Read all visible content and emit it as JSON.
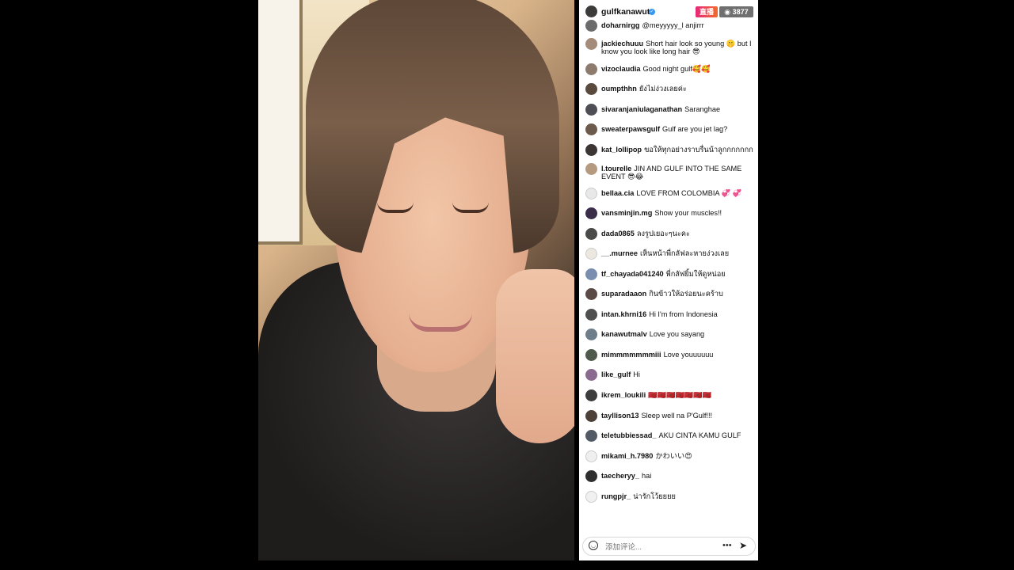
{
  "header": {
    "username": "gulfkanawut",
    "live_badge": "直播",
    "viewer_count": "3877"
  },
  "comments": [
    {
      "user": "doharnirgg",
      "text": "@meyyyyy_l anjirrr",
      "avatar_color": "#6b6b6b"
    },
    {
      "user": "jackiechuuu",
      "text": "Short hair look so young 🤫 but I know you look like long hair 😎",
      "avatar_color": "#a48b7a"
    },
    {
      "user": "vizoclaudia",
      "text": "Good night gulf🥰🥰",
      "avatar_color": "#8d7b6e"
    },
    {
      "user": "oumpthhn",
      "text": "ยังไม่ง่วงเลยค่ะ",
      "avatar_color": "#5a4a3e"
    },
    {
      "user": "sivaranjaniulaganathan",
      "text": "Saranghae",
      "avatar_color": "#4e4e55"
    },
    {
      "user": "sweaterpawsgulf",
      "text": "Gulf are you jet lag?",
      "avatar_color": "#6c5a4c"
    },
    {
      "user": "kat_lollipop",
      "text": "ขอให้ทุกอย่างราบรื่นน้าลูกกกกกกก",
      "avatar_color": "#3b3534"
    },
    {
      "user": "l.tourelle",
      "text": "JIN AND GULF INTO THE SAME EVENT 😎😂",
      "avatar_color": "#b59a7f"
    },
    {
      "user": "bellaa.cia",
      "text": "LOVE FROM COLOMBIA 💞 💞",
      "avatar_color": "#e8e8e8"
    },
    {
      "user": "vansminjin.mg",
      "text": "Show your muscles!!",
      "avatar_color": "#3a2d4a"
    },
    {
      "user": "dada0865",
      "text": "ลงรูปเยอะๆนะคะ",
      "avatar_color": "#4a4a48"
    },
    {
      "user": "__.murnee",
      "text": "เห็นหน้าพี่กลัฟละหายง่วงเลย",
      "avatar_color": "#ece8df"
    },
    {
      "user": "tf_chayada041240",
      "text": "พี่กลัฟยิ้มให้ดูหน่อย",
      "avatar_color": "#7a8fb0"
    },
    {
      "user": "suparadaaon",
      "text": "กินข้าวให้อร่อยนะคร้าบ",
      "avatar_color": "#5a4a46"
    },
    {
      "user": "intan.khrni16",
      "text": "Hi I'm from Indonesia",
      "avatar_color": "#4f4f4f"
    },
    {
      "user": "kanawutmalv",
      "text": "Love you sayang",
      "avatar_color": "#6d7d8a"
    },
    {
      "user": "mimmmmmmmiii",
      "text": "Love youuuuuu",
      "avatar_color": "#505a4c"
    },
    {
      "user": "like_gulf",
      "text": "Hi",
      "avatar_color": "#8a6a8e"
    },
    {
      "user": "ikrem_loukili",
      "text": "🇲🇦🇲🇦🇲🇦🇲🇦🇲🇦🇲🇦🇲🇦",
      "avatar_color": "#3d3d3d"
    },
    {
      "user": "tayllison13",
      "text": "Sleep well na P'Gulf!!!",
      "avatar_color": "#4d4038"
    },
    {
      "user": "teletubbiessad_",
      "text": "AKU CINTA KAMU GULF",
      "avatar_color": "#525a66"
    },
    {
      "user": "mikami_h.7980",
      "text": "かわいい😍",
      "avatar_color": "#efefef"
    },
    {
      "user": "taecheryy_",
      "text": "hai",
      "avatar_color": "#2e2e2e"
    },
    {
      "user": "rungpjr_",
      "text": "น่ารักโว้ยยยย",
      "avatar_color": "#f0f0f0"
    }
  ],
  "composer": {
    "placeholder": "添加评论..."
  },
  "colors": {
    "live_gradient_start": "#e6287a",
    "live_gradient_end": "#f06b2a",
    "viewer_badge": "#6f6f6f",
    "verified": "#3897f0"
  }
}
